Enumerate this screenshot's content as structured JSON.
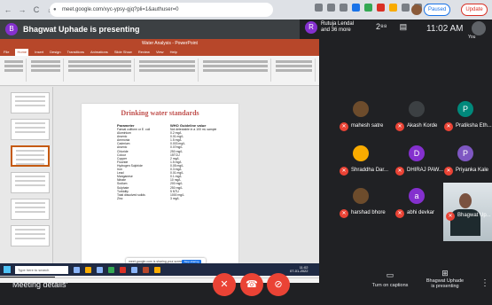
{
  "browser": {
    "nav": [
      "←",
      "→",
      "C",
      "⌂"
    ],
    "url": "meet.google.com/xyc-ypsy-gjq?pli=1&authuser=0",
    "paused_label": "Paused",
    "update_label": "Update"
  },
  "meet": {
    "presenter_banner": "Bhagwat Uphade is presenting",
    "presenter_initial": "B",
    "people_initial": "R",
    "people_line1": "Rutuja Lendal",
    "people_line2": "and 36 more",
    "people_count_icon": "2⁸⁸",
    "clock": "11:02 AM",
    "you_label": "You"
  },
  "ppt": {
    "title_center": "Water Analysis - PowerPoint",
    "tabs": [
      "File",
      "Home",
      "Insert",
      "Design",
      "Transitions",
      "Animations",
      "Slide Show",
      "Review",
      "View",
      "Help"
    ],
    "active_tab": "Home",
    "slide_title": "Drinking water standards",
    "col_param": "Parameter",
    "col_who": "WHO Guideline value",
    "rows": [
      {
        "p": "Faecal coliform or E. coli",
        "v": "Not detectable in a 100 mL sample"
      },
      {
        "p": "Aluminium",
        "v": "0.2 mg/L"
      },
      {
        "p": "Arsenic",
        "v": "0.01 mg/L"
      },
      {
        "p": "Ammonia",
        "v": "1.5 mg/L"
      },
      {
        "p": "Cadmium",
        "v": "0.003 mg/L"
      },
      {
        "p": "Arsenic",
        "v": "0.07mg/L"
      },
      {
        "p": "Chloride",
        "v": "250 mg/L"
      },
      {
        "p": "Colour",
        "v": "15TCU"
      },
      {
        "p": "Copper",
        "v": "2 mg/L"
      },
      {
        "p": "Fluoride",
        "v": "1.5 mg/L"
      },
      {
        "p": "Hydrogen Sulphide",
        "v": "0.05 mg/L"
      },
      {
        "p": "Iron",
        "v": "0.3 mg/L"
      },
      {
        "p": "Lead",
        "v": "0.01 mg/L"
      },
      {
        "p": "Manganese",
        "v": "0.1 mg/L"
      },
      {
        "p": "Nitrate",
        "v": "10 mg/L"
      },
      {
        "p": "Sodium",
        "v": "200 mg/L"
      },
      {
        "p": "Sulphate",
        "v": "250 mg/L"
      },
      {
        "p": "Turbidity",
        "v": "5 NTU"
      },
      {
        "p": "Total dissolved solids",
        "v": "1000 mg/L"
      },
      {
        "p": "Zinc",
        "v": "3 mg/L"
      }
    ],
    "notes_placeholder": "Click to add notes",
    "share_text": "meet.google.com is sharing your screen.",
    "share_stop": "Stop sharing",
    "search_placeholder": "Type here to search",
    "tray_time": "11:02",
    "tray_date": "07-01-2022"
  },
  "participants": [
    {
      "name": "mahesh satre",
      "initial": "",
      "color": "#6d4c2c"
    },
    {
      "name": "Akash Korde",
      "initial": "",
      "color": "#3c4043"
    },
    {
      "name": "Pratiksha Eth...",
      "initial": "P",
      "color": "#00897b"
    },
    {
      "name": "Shraddha Dar...",
      "initial": "",
      "color": "#f9ab00"
    },
    {
      "name": "DHIRAJ PAW...",
      "initial": "D",
      "color": "#8430ce"
    },
    {
      "name": "Priyanka Kale",
      "initial": "P",
      "color": "#7e57c2"
    },
    {
      "name": "harshad bhore",
      "initial": "",
      "color": "#6d4c2c"
    },
    {
      "name": "abhi devkar",
      "initial": "a",
      "color": "#8430ce"
    }
  ],
  "video_participant": "Bhagwat Up...",
  "bottom": {
    "meeting_details": "Meeting details",
    "chevron": "^",
    "captions": "Turn on captions",
    "presenting_line1": "Bhagwat Uphade",
    "presenting_line2": "is presenting",
    "more": "⋮"
  },
  "colors": {
    "end_call": "#ea4335",
    "ppt_accent": "#b7472a",
    "slide_title": "#c0504d"
  }
}
